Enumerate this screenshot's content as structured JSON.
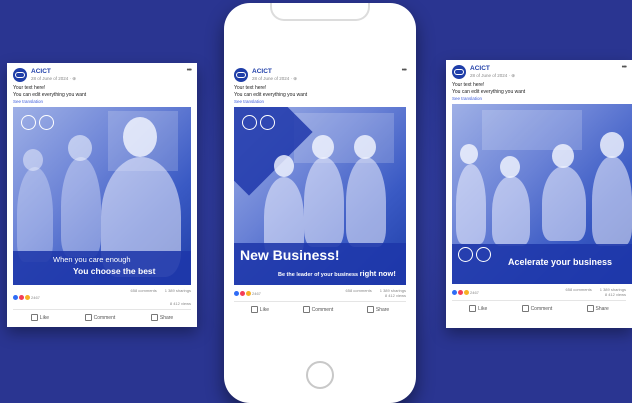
{
  "colors": {
    "background": "#2a3591",
    "brand": "#1f3ea8",
    "link": "#3b5bdb"
  },
  "left_card": {
    "page_name": "ACICT",
    "date": "28 of June of 2024 · ⊕",
    "text_line1": "Your text here!",
    "text_line2": "You can edit everything you want",
    "see_translation": "See translation",
    "overlay_line1": "When you care enough",
    "overlay_line2": "You choose the best",
    "reactions_count": "2467",
    "comments": "658 comments",
    "shares": "1 389 sharings",
    "views": "8 412 views",
    "like": "Like",
    "comment": "Comment",
    "share": "Share"
  },
  "phone_card": {
    "page_name": "ACICT",
    "date": "28 of June of 2024 · ⊕",
    "text_line1": "Your text here!",
    "text_line2": "You can edit everything you want",
    "see_translation": "See translation",
    "headline": "New Business!",
    "subline_start": "Be the leader of your business",
    "subline_end": "right now!",
    "reactions_count": "2467",
    "comments": "658 comments",
    "shares": "1 389 sharings",
    "views": "8 412 views",
    "like": "Like",
    "comment": "Comment",
    "share": "Share"
  },
  "right_card": {
    "page_name": "ACICT",
    "date": "28 of June of 2024 · ⊕",
    "text_line1": "Your text here!",
    "text_line2": "You can edit everything you want",
    "see_translation": "See translation",
    "headline": "Acelerate your business",
    "reactions_count": "2467",
    "comments": "658 comments",
    "shares": "1 389 sharings",
    "views": "8 412 views",
    "like": "Like",
    "comment": "Comment",
    "share": "Share"
  }
}
